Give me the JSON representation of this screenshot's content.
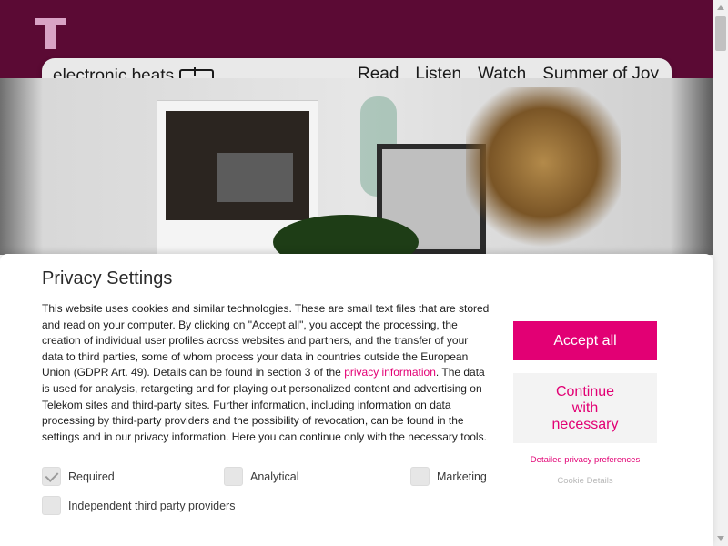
{
  "header": {
    "brand": "electronic beats",
    "nav": [
      "Read",
      "Listen",
      "Watch",
      "Summer of Joy"
    ]
  },
  "privacy": {
    "title": "Privacy Settings",
    "body_part1": "This website uses cookies and similar technologies. These are small text files that are stored and read on your computer. By clicking on \"Accept all\", you accept the processing, the creation of individual user profiles across websites and partners, and the transfer of your data to third parties, some of whom process your data in countries outside the European Union (GDPR Art. 49). Details can be found in section 3 of the ",
    "body_link": "privacy information",
    "body_part2": ". The data is used for analysis, retargeting and for playing out personalized content and advertising on Telekom sites and third-party sites. Further information, including information on data processing by third-party providers and the possibility of revocation, can be found in the settings and in our privacy information. Here you can continue only with the necessary tools.",
    "checkboxes": [
      {
        "label": "Required",
        "checked": true
      },
      {
        "label": "Analytical",
        "checked": false
      },
      {
        "label": "Marketing",
        "checked": false
      },
      {
        "label": "Independent third party providers",
        "checked": false
      }
    ],
    "accept_all": "Accept all",
    "continue_necessary": "Continue with necessary",
    "detailed_prefs": "Detailed privacy preferences",
    "cookie_details": "Cookie Details"
  },
  "colors": {
    "brand_magenta": "#e20074",
    "header_bar": "#5b0a34"
  }
}
